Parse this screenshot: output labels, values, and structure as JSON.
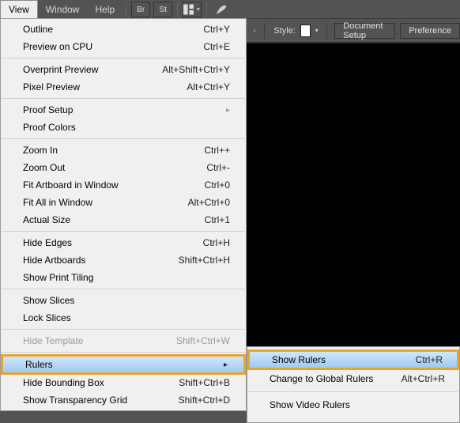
{
  "menubar": {
    "view": "View",
    "window": "Window",
    "help": "Help",
    "br": "Br",
    "st": "St"
  },
  "toolbar": {
    "style_label": "Style:",
    "document_setup": "Document Setup",
    "preferences": "Preference"
  },
  "menu": {
    "outline": {
      "label": "Outline",
      "accel": "Ctrl+Y"
    },
    "preview_cpu": {
      "label": "Preview on CPU",
      "accel": "Ctrl+E"
    },
    "overprint": {
      "label": "Overprint Preview",
      "accel": "Alt+Shift+Ctrl+Y"
    },
    "pixel": {
      "label": "Pixel Preview",
      "accel": "Alt+Ctrl+Y"
    },
    "proof_setup": {
      "label": "Proof Setup"
    },
    "proof_colors": {
      "label": "Proof Colors"
    },
    "zoom_in": {
      "label": "Zoom In",
      "accel": "Ctrl++"
    },
    "zoom_out": {
      "label": "Zoom Out",
      "accel": "Ctrl+-"
    },
    "fit_artboard": {
      "label": "Fit Artboard in Window",
      "accel": "Ctrl+0"
    },
    "fit_all": {
      "label": "Fit All in Window",
      "accel": "Alt+Ctrl+0"
    },
    "actual_size": {
      "label": "Actual Size",
      "accel": "Ctrl+1"
    },
    "hide_edges": {
      "label": "Hide Edges",
      "accel": "Ctrl+H"
    },
    "hide_artboards": {
      "label": "Hide Artboards",
      "accel": "Shift+Ctrl+H"
    },
    "show_print_tiling": {
      "label": "Show Print Tiling"
    },
    "show_slices": {
      "label": "Show Slices"
    },
    "lock_slices": {
      "label": "Lock Slices"
    },
    "hide_template": {
      "label": "Hide Template",
      "accel": "Shift+Ctrl+W"
    },
    "rulers": {
      "label": "Rulers"
    },
    "hide_bounding": {
      "label": "Hide Bounding Box",
      "accel": "Shift+Ctrl+B"
    },
    "show_transparency": {
      "label": "Show Transparency Grid",
      "accel": "Shift+Ctrl+D"
    }
  },
  "submenu": {
    "show_rulers": {
      "label": "Show Rulers",
      "accel": "Ctrl+R"
    },
    "change_global": {
      "label": "Change to Global Rulers",
      "accel": "Alt+Ctrl+R"
    },
    "show_video_rulers": {
      "label": "Show Video Rulers"
    }
  }
}
